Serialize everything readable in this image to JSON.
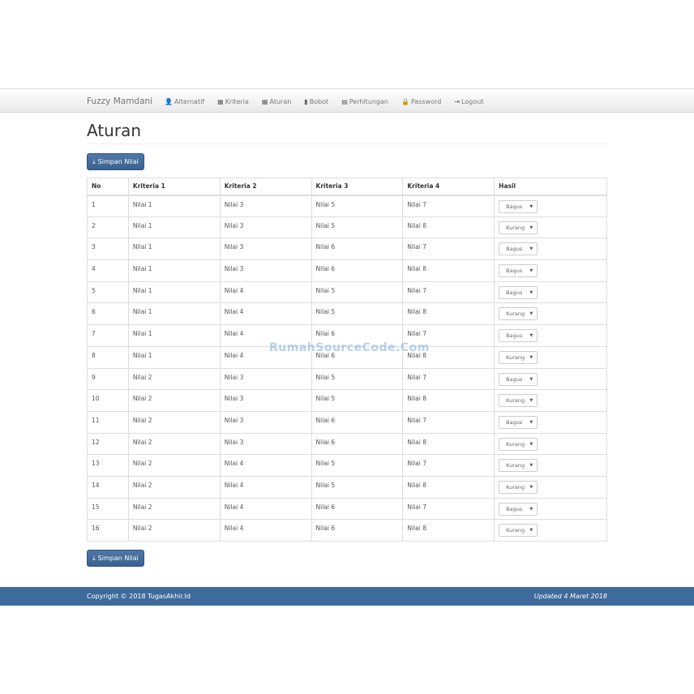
{
  "nav": {
    "brand": "Fuzzy Mamdani",
    "items": [
      {
        "label": "Alternatif",
        "icon": "user-icon",
        "glyph": "👤"
      },
      {
        "label": "Kriteria",
        "icon": "th-large-icon",
        "glyph": "▦"
      },
      {
        "label": "Aturan",
        "icon": "th-icon",
        "glyph": "▦"
      },
      {
        "label": "Bobot",
        "icon": "signal-icon",
        "glyph": "▮"
      },
      {
        "label": "Perhitungan",
        "icon": "calendar-icon",
        "glyph": "▤"
      },
      {
        "label": "Password",
        "icon": "lock-icon",
        "glyph": "🔒"
      },
      {
        "label": "Logout",
        "icon": "log-out-icon",
        "glyph": "⇥"
      }
    ]
  },
  "page_title": "Aturan",
  "save_label": "Simpan Nilai",
  "table": {
    "headers": [
      "No",
      "Kriteria 1",
      "Kriteria 2",
      "Kriteria 3",
      "Kriteria 4",
      "Hasil"
    ],
    "rows": [
      [
        "1",
        "Nilai 1",
        "Nilai 3",
        "Nilai 5",
        "Nilai 7",
        "Bagus"
      ],
      [
        "2",
        "Nilai 1",
        "Nilai 3",
        "Nilai 5",
        "Nilai 8",
        "Kurang"
      ],
      [
        "3",
        "Nilai 1",
        "Nilai 3",
        "Nilai 6",
        "Nilai 7",
        "Bagus"
      ],
      [
        "4",
        "Nilai 1",
        "Nilai 3",
        "Nilai 6",
        "Nilai 8",
        "Bagus"
      ],
      [
        "5",
        "Nilai 1",
        "Nilai 4",
        "Nilai 5",
        "Nilai 7",
        "Bagus"
      ],
      [
        "6",
        "Nilai 1",
        "Nilai 4",
        "Nilai 5",
        "Nilai 8",
        "Kurang"
      ],
      [
        "7",
        "Nilai 1",
        "Nilai 4",
        "Nilai 6",
        "Nilai 7",
        "Bagus"
      ],
      [
        "8",
        "Nilai 1",
        "Nilai 4",
        "Nilai 6",
        "Nilai 8",
        "Kurang"
      ],
      [
        "9",
        "Nilai 2",
        "Nilai 3",
        "Nilai 5",
        "Nilai 7",
        "Bagus"
      ],
      [
        "10",
        "Nilai 2",
        "Nilai 3",
        "Nilai 5",
        "Nilai 8",
        "Kurang"
      ],
      [
        "11",
        "Nilai 2",
        "Nilai 3",
        "Nilai 6",
        "Nilai 7",
        "Bagus"
      ],
      [
        "12",
        "Nilai 2",
        "Nilai 3",
        "Nilai 6",
        "Nilai 8",
        "Kurang"
      ],
      [
        "13",
        "Nilai 2",
        "Nilai 4",
        "Nilai 5",
        "Nilai 7",
        "Kurang"
      ],
      [
        "14",
        "Nilai 2",
        "Nilai 4",
        "Nilai 5",
        "Nilai 8",
        "Kurang"
      ],
      [
        "15",
        "Nilai 2",
        "Nilai 4",
        "Nilai 6",
        "Nilai 7",
        "Bagus"
      ],
      [
        "16",
        "Nilai 2",
        "Nilai 4",
        "Nilai 6",
        "Nilai 8",
        "Kurang"
      ]
    ]
  },
  "footer": {
    "copyright": "Copyright © 2018 TugasAkhir.Id",
    "updated": "Updated 4 Maret 2018"
  },
  "watermark": "RumahSourceCode.Com"
}
